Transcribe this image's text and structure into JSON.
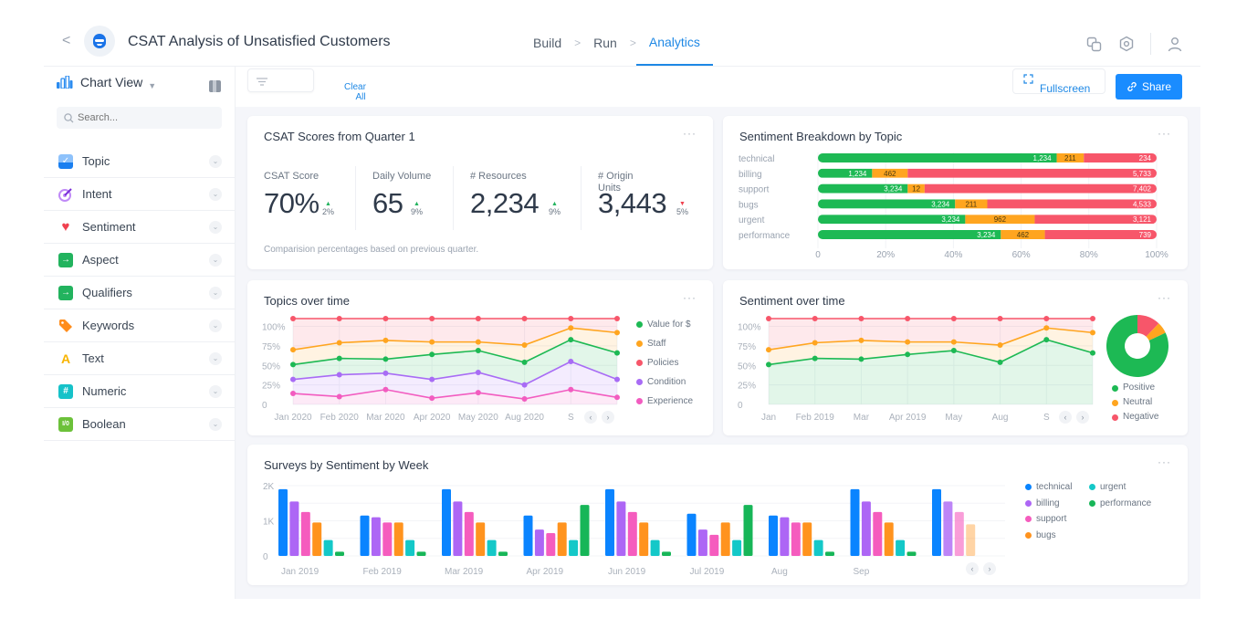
{
  "header": {
    "back_label": "<",
    "app_title": "CSAT Analysis of Unsatisfied Customers",
    "logo_icon": "robot-logo-icon",
    "breadcrumbs": [
      {
        "label": "Build",
        "active": false
      },
      {
        "label": "Run",
        "active": false
      },
      {
        "label": "Analytics",
        "active": true
      }
    ],
    "icons": [
      "copy-icon",
      "settings-icon",
      "user-icon"
    ]
  },
  "sidebar": {
    "view_label": "Chart View",
    "search_placeholder": "Search...",
    "items": [
      {
        "label": "Topic",
        "icon": "topic-icon",
        "color": "#2b8cf0"
      },
      {
        "label": "Intent",
        "icon": "intent-icon",
        "color": "#a34bf0"
      },
      {
        "label": "Sentiment",
        "icon": "heart-icon",
        "color": "#f0414f"
      },
      {
        "label": "Aspect",
        "icon": "aspect-icon",
        "color": "#22b35e"
      },
      {
        "label": "Qualifiers",
        "icon": "qualifiers-icon",
        "color": "#22b35e"
      },
      {
        "label": "Keywords",
        "icon": "tag-icon",
        "color": "#ff8c1a"
      },
      {
        "label": "Text",
        "icon": "text-icon",
        "color": "#f8b400"
      },
      {
        "label": "Numeric",
        "icon": "hash-icon",
        "color": "#16c2c9"
      },
      {
        "label": "Boolean",
        "icon": "boolean-icon",
        "color": "#6cc13a"
      }
    ]
  },
  "toolbar": {
    "clear_all_line1": "Clear",
    "clear_all_line2": "All",
    "fullscreen_label": "Fullscreen",
    "share_label": "Share"
  },
  "csat_card": {
    "title": "CSAT Scores from Quarter 1",
    "menu": "···",
    "kpis": [
      {
        "label": "CSAT Score",
        "value": "70%",
        "delta": "2%",
        "direction": "up"
      },
      {
        "label": "Daily Volume",
        "value": "65",
        "delta": "9%",
        "direction": "up"
      },
      {
        "label": "# Resources",
        "value": "2,234",
        "delta": "9%",
        "direction": "up"
      },
      {
        "label": "# Origin Units",
        "value": "3,443",
        "delta": "5%",
        "direction": "down"
      }
    ],
    "note": "Comparision percentages based on previous quarter."
  },
  "colors": {
    "positive": "#1db954",
    "neutral": "#ffa51f",
    "negative": "#f7566a",
    "accent": "#1a8cff"
  },
  "chart_data": [
    {
      "id": "sentiment_breakdown",
      "type": "bar",
      "orientation": "horizontal-stacked-percent",
      "title": "Sentiment Breakdown by Topic",
      "categories": [
        "technical",
        "billing",
        "support",
        "bugs",
        "urgent",
        "performance"
      ],
      "series": [
        {
          "name": "Positive",
          "color": "#1db954",
          "values": [
            1234,
            1234,
            3234,
            3234,
            3234,
            3234
          ],
          "labels": [
            "1,234",
            "1,234",
            "3,234",
            "3,234",
            "3,234",
            "3,234"
          ],
          "share": [
            0.705,
            0.16,
            0.265,
            0.405,
            0.435,
            0.54
          ]
        },
        {
          "name": "Neutral",
          "color": "#ffa51f",
          "values": [
            211,
            462,
            12,
            211,
            962,
            462
          ],
          "labels": [
            "211",
            "462",
            "12",
            "211",
            "962",
            "462"
          ],
          "share": [
            0.08,
            0.105,
            0.05,
            0.095,
            0.205,
            0.13
          ]
        },
        {
          "name": "Negative",
          "color": "#f7566a",
          "values": [
            234,
            5733,
            7402,
            4533,
            3121,
            739
          ],
          "labels": [
            "234",
            "5,733",
            "7,402",
            "4,533",
            "3,121",
            "739"
          ],
          "share": [
            0.215,
            0.735,
            0.685,
            0.5,
            0.36,
            0.33
          ]
        }
      ],
      "xticks": [
        "0",
        "20%",
        "40%",
        "60%",
        "80%",
        "100%"
      ],
      "xlim": [
        0,
        100
      ]
    },
    {
      "id": "topics_over_time",
      "type": "area",
      "title": "Topics over time",
      "x": [
        "Jan 2020",
        "Feb 2020",
        "Mar 2020",
        "Apr 2020",
        "May 2020",
        "Aug 2020",
        "S",
        ""
      ],
      "yticks": [
        "0",
        "25%",
        "50%",
        "75%",
        "100%"
      ],
      "ylim": [
        0,
        110
      ],
      "series": [
        {
          "name": "Policies",
          "color": "#f7566a",
          "values": [
            110,
            110,
            110,
            110,
            110,
            110,
            110,
            110
          ]
        },
        {
          "name": "Staff",
          "color": "#ffa51f",
          "values": [
            70,
            79,
            82,
            80,
            80,
            76,
            98,
            92
          ]
        },
        {
          "name": "Value for $",
          "color": "#1db954",
          "values": [
            51,
            59,
            58,
            64,
            69,
            54,
            83,
            66
          ]
        },
        {
          "name": "Condition",
          "color": "#a86cf5",
          "values": [
            32,
            38,
            40,
            32,
            41,
            25,
            55,
            32
          ]
        },
        {
          "name": "Experience",
          "color": "#f25cc0",
          "values": [
            14,
            10,
            19,
            8,
            15,
            7,
            19,
            9
          ]
        }
      ],
      "legend": [
        "Value for $",
        "Staff",
        "Policies",
        "Condition",
        "Experience"
      ],
      "legend_colors": [
        "#1db954",
        "#ffa51f",
        "#f7566a",
        "#a86cf5",
        "#f25cc0"
      ],
      "legend_position": "right"
    },
    {
      "id": "sentiment_over_time",
      "type": "area",
      "title": "Sentiment over time",
      "x": [
        "Jan",
        "Feb 2019",
        "Mar",
        "Apr 2019",
        "May",
        "Aug",
        "S",
        ""
      ],
      "yticks": [
        "0",
        "25%",
        "50%",
        "75%",
        "100%"
      ],
      "ylim": [
        0,
        110
      ],
      "series": [
        {
          "name": "Negative",
          "color": "#f7566a",
          "values": [
            110,
            110,
            110,
            110,
            110,
            110,
            110,
            110
          ]
        },
        {
          "name": "Neutral",
          "color": "#ffa51f",
          "values": [
            70,
            79,
            82,
            80,
            80,
            76,
            98,
            92
          ]
        },
        {
          "name": "Positive",
          "color": "#1db954",
          "values": [
            51,
            59,
            58,
            64,
            69,
            54,
            83,
            66
          ]
        }
      ]
    },
    {
      "id": "sentiment_donut",
      "type": "pie",
      "labels": [
        "Negative",
        "Neutral",
        "Positive"
      ],
      "values": [
        12,
        6,
        82
      ],
      "colors": [
        "#f7566a",
        "#ffa51f",
        "#1db954"
      ],
      "legend": [
        "Positive",
        "Neutral",
        "Negative"
      ],
      "legend_colors": [
        "#1db954",
        "#ffa51f",
        "#f7566a"
      ],
      "legend_position": "bottom"
    },
    {
      "id": "surveys_by_week",
      "type": "bar",
      "title": "Surveys by Sentiment by Week",
      "categories": [
        "Jan 2019",
        "Feb 2019",
        "Mar 2019",
        "Apr 2019",
        "Jun 2019",
        "Jul 2019",
        "Aug",
        "Sep",
        ""
      ],
      "yticks": [
        "0",
        "1K",
        "2K"
      ],
      "ylim": [
        0,
        2000
      ],
      "series": [
        {
          "name": "technical",
          "color": "#0a84ff",
          "values": [
            1900,
            1150,
            1900,
            1150,
            1900,
            1200,
            1150,
            1900,
            1900
          ]
        },
        {
          "name": "billing",
          "color": "#ad66f5",
          "values": [
            1550,
            1100,
            1550,
            750,
            1550,
            750,
            1100,
            1550,
            1550
          ]
        },
        {
          "name": "support",
          "color": "#f55cbe",
          "values": [
            1250,
            950,
            1250,
            650,
            1250,
            600,
            950,
            1250,
            1250
          ]
        },
        {
          "name": "bugs",
          "color": "#ff931e",
          "values": [
            950,
            950,
            950,
            950,
            950,
            950,
            950,
            950,
            900
          ]
        },
        {
          "name": "urgent",
          "color": "#14c8c8",
          "values": [
            450,
            450,
            450,
            450,
            450,
            450,
            450,
            450,
            0
          ]
        },
        {
          "name": "performance",
          "color": "#17b658",
          "values": [
            120,
            120,
            120,
            1450,
            120,
            1450,
            120,
            120,
            0
          ]
        }
      ],
      "legend": [
        [
          "technical",
          "urgent"
        ],
        [
          "billing",
          "performance"
        ],
        [
          "support"
        ],
        [
          "bugs"
        ]
      ],
      "legend_position": "right"
    }
  ],
  "cards": {
    "sentiment_breakdown_title": "Sentiment Breakdown by Topic",
    "topics_title": "Topics over time",
    "sentiment_time_title": "Sentiment over time",
    "surveys_title": "Surveys by Sentiment by Week",
    "menu": "···",
    "prev": "‹",
    "next": "›"
  }
}
